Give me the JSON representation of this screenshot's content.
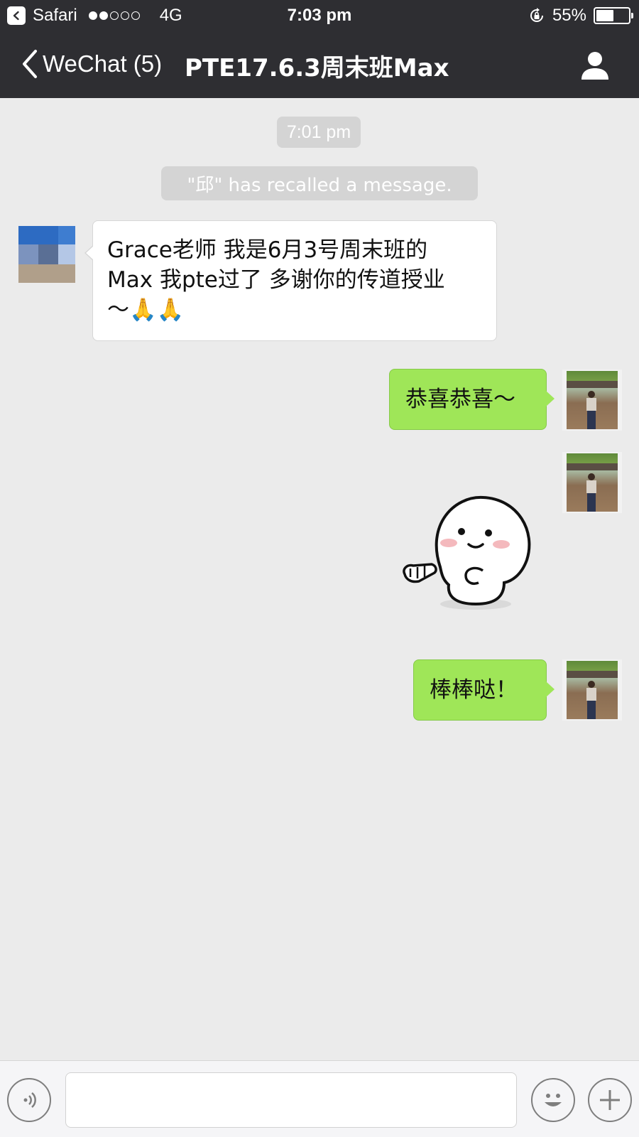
{
  "status_bar": {
    "back_app": "Safari",
    "network": "4G",
    "time": "7:03 pm",
    "battery": "55%",
    "battery_level": 0.55
  },
  "nav": {
    "back_label": "WeChat (5)",
    "title": "PTE17.6.3周末班Max"
  },
  "chat": {
    "timestamp": "7:01 pm",
    "system_notice": "\"邱\" has recalled a message.",
    "messages": [
      {
        "side": "left",
        "text": "Grace老师 我是6月3号周末班的\nMax 我pte过了 多谢你的传道授业\n～🙏🙏"
      },
      {
        "side": "right",
        "text": "恭喜恭喜～"
      },
      {
        "side": "right",
        "text": "[sticker]"
      },
      {
        "side": "right",
        "text": "棒棒哒！"
      }
    ]
  },
  "input_bar": {
    "placeholder": ""
  },
  "icons": {
    "back": "chevron-left-icon",
    "profile": "person-icon",
    "voice": "voice-icon",
    "emoji": "emoji-icon",
    "plus": "plus-icon"
  },
  "colors": {
    "bar_bg": "#2e2e32",
    "chat_bg": "#ebebeb",
    "bubble_green": "#9fe658",
    "bubble_white": "#ffffff",
    "pill_gray": "#d4d4d4"
  }
}
